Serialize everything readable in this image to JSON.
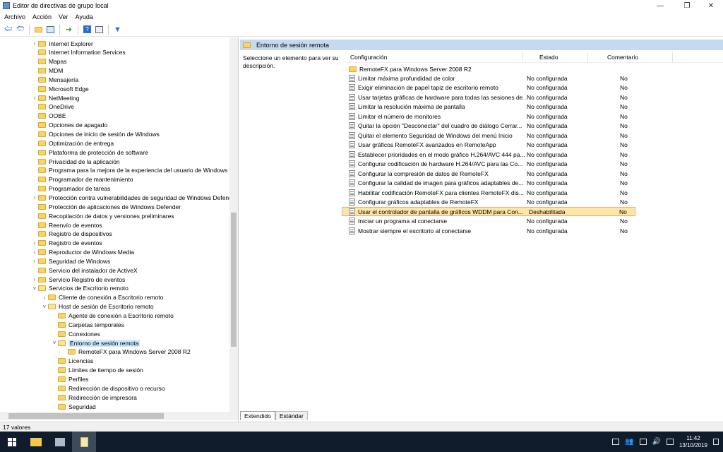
{
  "window": {
    "title": "Editor de directivas de grupo local"
  },
  "menu": [
    "Archivo",
    "Acción",
    "Ver",
    "Ayuda"
  ],
  "tree": [
    {
      "label": "Internet Explorer",
      "level": 1,
      "expander": ">"
    },
    {
      "label": "Internet Information Services",
      "level": 1,
      "expander": ""
    },
    {
      "label": "Mapas",
      "level": 1,
      "expander": ""
    },
    {
      "label": "MDM",
      "level": 1,
      "expander": ""
    },
    {
      "label": "Mensajería",
      "level": 1,
      "expander": ""
    },
    {
      "label": "Microsoft Edge",
      "level": 1,
      "expander": ""
    },
    {
      "label": "NetMeeting",
      "level": 1,
      "expander": ">"
    },
    {
      "label": "OneDrive",
      "level": 1,
      "expander": ""
    },
    {
      "label": "OOBE",
      "level": 1,
      "expander": ""
    },
    {
      "label": "Opciones de apagado",
      "level": 1,
      "expander": ""
    },
    {
      "label": "Opciones de inicio de sesión de Windows",
      "level": 1,
      "expander": ""
    },
    {
      "label": "Optimización de entrega",
      "level": 1,
      "expander": ""
    },
    {
      "label": "Plataforma de protección de software",
      "level": 1,
      "expander": ""
    },
    {
      "label": "Privacidad de la aplicación",
      "level": 1,
      "expander": ""
    },
    {
      "label": "Programa para la mejora de la experiencia del usuario de Windows",
      "level": 1,
      "expander": ""
    },
    {
      "label": "Programador de mantenimiento",
      "level": 1,
      "expander": ""
    },
    {
      "label": "Programador de tareas",
      "level": 1,
      "expander": ""
    },
    {
      "label": "Protección contra vulnerabilidades de seguridad de Windows Defender",
      "level": 1,
      "expander": ">"
    },
    {
      "label": "Protección de aplicaciones de Windows Defender",
      "level": 1,
      "expander": ""
    },
    {
      "label": "Recopilación de datos y versiones preliminares",
      "level": 1,
      "expander": ""
    },
    {
      "label": "Reenvío de eventos",
      "level": 1,
      "expander": ""
    },
    {
      "label": "Registro de dispositivos",
      "level": 1,
      "expander": ""
    },
    {
      "label": "Registro de eventos",
      "level": 1,
      "expander": ">"
    },
    {
      "label": "Reproductor de Windows Media",
      "level": 1,
      "expander": ">"
    },
    {
      "label": "Seguridad de Windows",
      "level": 1,
      "expander": ">"
    },
    {
      "label": "Servicio del instalador de ActiveX",
      "level": 1,
      "expander": ""
    },
    {
      "label": "Servicio Registro de eventos",
      "level": 1,
      "expander": ">"
    },
    {
      "label": "Servicios de Escritorio remoto",
      "level": 1,
      "expander": "v"
    },
    {
      "label": "Cliente de conexión a Escritorio remoto",
      "level": 2,
      "expander": ">"
    },
    {
      "label": "Host de sesión de Escritorio remoto",
      "level": 2,
      "expander": "v"
    },
    {
      "label": "Agente de conexión a Escritorio remoto",
      "level": 3,
      "expander": ""
    },
    {
      "label": "Carpetas temporales",
      "level": 3,
      "expander": ""
    },
    {
      "label": "Conexiones",
      "level": 3,
      "expander": ""
    },
    {
      "label": "Entorno de sesión remota",
      "level": 3,
      "expander": "v",
      "selected": true
    },
    {
      "label": "RemoteFX para Windows Server 2008 R2",
      "level": 4,
      "expander": ""
    },
    {
      "label": "Licencias",
      "level": 3,
      "expander": ""
    },
    {
      "label": "Límites de tiempo de sesión",
      "level": 3,
      "expander": ""
    },
    {
      "label": "Perfiles",
      "level": 3,
      "expander": ""
    },
    {
      "label": "Redirección de dispositivo o recurso",
      "level": 3,
      "expander": ""
    },
    {
      "label": "Redirección de impresora",
      "level": 3,
      "expander": ""
    },
    {
      "label": "Seguridad",
      "level": 3,
      "expander": ""
    }
  ],
  "right": {
    "header": "Entorno de sesión remota",
    "description": "Seleccione un elemento para ver su descripción.",
    "columns": {
      "config": "Configuración",
      "state": "Estado",
      "comment": "Comentario"
    },
    "folder_row": "RemoteFX para Windows Server 2008 R2",
    "policies": [
      {
        "name": "Limitar máxima profundidad de color",
        "state": "No configurada",
        "comment": "No"
      },
      {
        "name": "Exigir eliminación de papel tapiz de escritorio remoto",
        "state": "No configurada",
        "comment": "No"
      },
      {
        "name": "Usar tarjetas gráficas de hardware para todas las sesiones de ...",
        "state": "No configurada",
        "comment": "No"
      },
      {
        "name": "Limitar la resolución máxima de pantalla",
        "state": "No configurada",
        "comment": "No"
      },
      {
        "name": "Limitar el número de monitores",
        "state": "No configurada",
        "comment": "No"
      },
      {
        "name": "Quitar la opción \"Desconectar\" del cuadro de diálogo Cerrar...",
        "state": "No configurada",
        "comment": "No"
      },
      {
        "name": "Quitar el elemento Seguridad de Windows del menú Inicio",
        "state": "No configurada",
        "comment": "No"
      },
      {
        "name": "Usar gráficos RemoteFX avanzados en RemoteApp",
        "state": "No configurada",
        "comment": "No"
      },
      {
        "name": "Establecer prioridades en el modo gráfico H.264/AVC 444 pa...",
        "state": "No configurada",
        "comment": "No"
      },
      {
        "name": "Configurar codificación de hardware H.264/AVC para las Co...",
        "state": "No configurada",
        "comment": "No"
      },
      {
        "name": "Configurar la compresión de datos de RemoteFX",
        "state": "No configurada",
        "comment": "No"
      },
      {
        "name": "Configurar la calidad de imagen para gráficos adaptables de...",
        "state": "No configurada",
        "comment": "No"
      },
      {
        "name": "Habilitar codificación RemoteFX para clientes RemoteFX dis...",
        "state": "No configurada",
        "comment": "No"
      },
      {
        "name": "Configurar gráficos adaptables de RemoteFX",
        "state": "No configurada",
        "comment": "No"
      },
      {
        "name": "Usar el controlador de pantalla de gráficos WDDM para Con...",
        "state": "Deshabilitada",
        "comment": "No",
        "highlight": true
      },
      {
        "name": "Iniciar un programa al conectarse",
        "state": "No configurada",
        "comment": "No"
      },
      {
        "name": "Mostrar siempre el escritorio al conectarse",
        "state": "No configurada",
        "comment": "No"
      }
    ]
  },
  "tabs": [
    "Extendido",
    "Estándar"
  ],
  "status": "17 valores",
  "clock": {
    "time": "11:42",
    "date": "13/10/2019"
  },
  "colors": {
    "header_bg": "#c5d9f1",
    "selection": "#cce8ff",
    "highlight_bg": "#fde7a6",
    "highlight_border": "#f2a38a",
    "taskbar": "#101c2c",
    "folder": "#f6d36b"
  }
}
